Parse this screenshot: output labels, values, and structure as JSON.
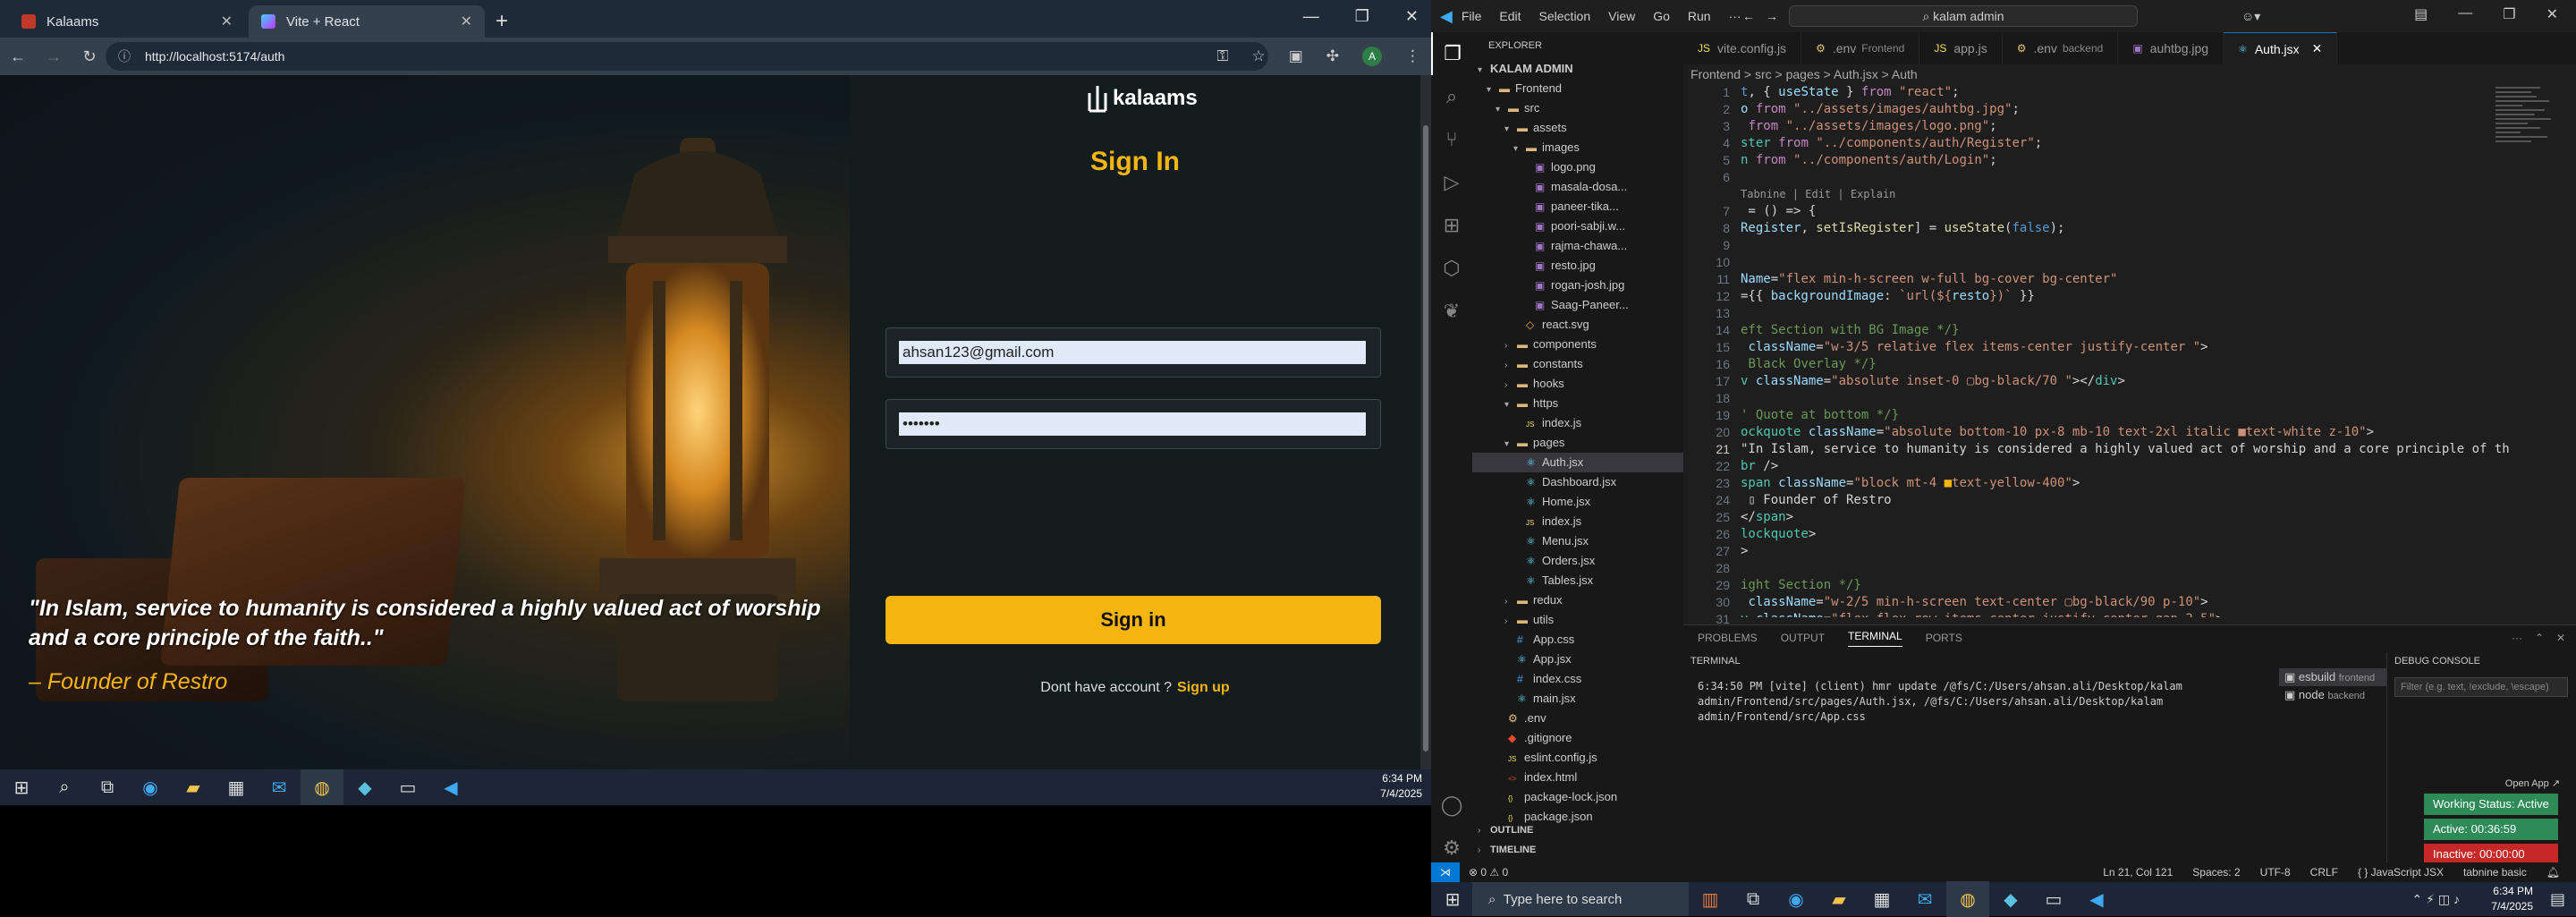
{
  "browser": {
    "tabs": [
      {
        "title": "Kalaams",
        "active": false
      },
      {
        "title": "Vite + React",
        "active": true
      }
    ],
    "url": "http://localhost:5174/auth"
  },
  "page": {
    "brand": "kalaams",
    "title": "Sign In",
    "email_value": "ahsan123@gmail.com",
    "password_value": "•••••••",
    "signin_label": "Sign in",
    "signup_prompt": "Dont have account ?",
    "signup_link": "Sign up",
    "quote": "\"In Islam, service to humanity is considered a highly valued act of worship and a core principle of the faith..\"",
    "author": "– Founder of Restro"
  },
  "taskbar_left": {
    "time": "6:34 PM",
    "date": "7/4/2025"
  },
  "vscode": {
    "menu": [
      "File",
      "Edit",
      "Selection",
      "View",
      "Go",
      "Run",
      "···"
    ],
    "search": "kalam admin",
    "explorer_title": "EXPLORER",
    "root": "KALAM ADMIN",
    "tree": [
      {
        "label": "Frontend",
        "level": 1,
        "type": "folder-open"
      },
      {
        "label": "src",
        "level": 2,
        "type": "folder-open"
      },
      {
        "label": "assets",
        "level": 3,
        "type": "folder-open"
      },
      {
        "label": "images",
        "level": 4,
        "type": "folder-open"
      },
      {
        "label": "logo.png",
        "level": 5,
        "type": "image"
      },
      {
        "label": "masala-dosa...",
        "level": 5,
        "type": "image"
      },
      {
        "label": "paneer-tika...",
        "level": 5,
        "type": "image"
      },
      {
        "label": "poori-sabji.w...",
        "level": 5,
        "type": "image"
      },
      {
        "label": "rajma-chawa...",
        "level": 5,
        "type": "image"
      },
      {
        "label": "resto.jpg",
        "level": 5,
        "type": "image"
      },
      {
        "label": "rogan-josh.jpg",
        "level": 5,
        "type": "image"
      },
      {
        "label": "Saag-Paneer...",
        "level": 5,
        "type": "image"
      },
      {
        "label": "react.svg",
        "level": 4,
        "type": "svg"
      },
      {
        "label": "components",
        "level": 3,
        "type": "folder"
      },
      {
        "label": "constants",
        "level": 3,
        "type": "folder"
      },
      {
        "label": "hooks",
        "level": 3,
        "type": "folder"
      },
      {
        "label": "https",
        "level": 3,
        "type": "folder-open"
      },
      {
        "label": "index.js",
        "level": 4,
        "type": "js"
      },
      {
        "label": "pages",
        "level": 3,
        "type": "folder-open"
      },
      {
        "label": "Auth.jsx",
        "level": 4,
        "type": "jsx",
        "selected": true
      },
      {
        "label": "Dashboard.jsx",
        "level": 4,
        "type": "jsx"
      },
      {
        "label": "Home.jsx",
        "level": 4,
        "type": "jsx"
      },
      {
        "label": "index.js",
        "level": 4,
        "type": "js"
      },
      {
        "label": "Menu.jsx",
        "level": 4,
        "type": "jsx"
      },
      {
        "label": "Orders.jsx",
        "level": 4,
        "type": "jsx"
      },
      {
        "label": "Tables.jsx",
        "level": 4,
        "type": "jsx"
      },
      {
        "label": "redux",
        "level": 3,
        "type": "folder"
      },
      {
        "label": "utils",
        "level": 3,
        "type": "folder"
      },
      {
        "label": "App.css",
        "level": 3,
        "type": "css"
      },
      {
        "label": "App.jsx",
        "level": 3,
        "type": "jsx"
      },
      {
        "label": "index.css",
        "level": 3,
        "type": "css"
      },
      {
        "label": "main.jsx",
        "level": 3,
        "type": "jsx"
      },
      {
        "label": ".env",
        "level": 2,
        "type": "env"
      },
      {
        "label": ".gitignore",
        "level": 2,
        "type": "git"
      },
      {
        "label": "eslint.config.js",
        "level": 2,
        "type": "js"
      },
      {
        "label": "index.html",
        "level": 2,
        "type": "html"
      },
      {
        "label": "package-lock.json",
        "level": 2,
        "type": "json"
      },
      {
        "label": "package.json",
        "level": 2,
        "type": "json"
      }
    ],
    "outline": "OUTLINE",
    "timeline": "TIMELINE",
    "tabs": [
      {
        "label": "vite.config.js",
        "sub": ""
      },
      {
        "label": ".env",
        "sub": "Frontend"
      },
      {
        "label": "app.js",
        "sub": ""
      },
      {
        "label": ".env",
        "sub": "backend"
      },
      {
        "label": "auhtbg.jpg",
        "sub": ""
      },
      {
        "label": "Auth.jsx",
        "sub": "",
        "active": true
      }
    ],
    "breadcrumb": "Frontend > src > pages > Auth.jsx > Auth",
    "line_numbers": [
      "1",
      "2",
      "3",
      "4",
      "5",
      "6",
      "",
      "7",
      "8",
      "9",
      "10",
      "11",
      "12",
      "13",
      "14",
      "15",
      "16",
      "17",
      "18",
      "19",
      "20",
      "21",
      "22",
      "23",
      "24",
      "25",
      "26",
      "27",
      "28",
      "29",
      "30",
      "31"
    ],
    "current_line": "21",
    "panel_tabs": [
      "PROBLEMS",
      "OUTPUT",
      "TERMINAL",
      "PORTS"
    ],
    "terminal_title": "TERMINAL",
    "terminal_output": "6:34:50 PM [vite] (client) hmr update /@fs/C:/Users/ahsan.ali/Desktop/kalam admin/Frontend/src/pages/Auth.jsx, /@fs/C:/Users/ahsan.ali/Desktop/kalam admin/Frontend/src/App.css",
    "terminals": [
      {
        "name": "esbuild",
        "folder": "frontend",
        "selected": true
      },
      {
        "name": "node",
        "folder": "backend"
      }
    ],
    "debug_title": "DEBUG CONSOLE",
    "debug_filter": "Filter (e.g. text, !exclude, \\escape)",
    "open_app": "Open App ↗",
    "working_status": "Working Status: Active",
    "active_time": "Active: 00:36:59",
    "inactive_time": "Inactive: 00:00:00",
    "status": {
      "errors": "⊗ 0  ⚠ 0",
      "position": "Ln 21, Col 121",
      "spaces": "Spaces: 2",
      "encoding": "UTF-8",
      "eol": "CRLF",
      "language": "{ } JavaScript JSX",
      "tabnine": "tabnine basic"
    },
    "colors": {
      "accent": "#0078d4",
      "working": "#2e8b57",
      "inactive": "#c62828"
    }
  },
  "taskbar_right": {
    "search_placeholder": "Type here to search",
    "time": "6:34 PM",
    "date": "7/4/2025"
  }
}
